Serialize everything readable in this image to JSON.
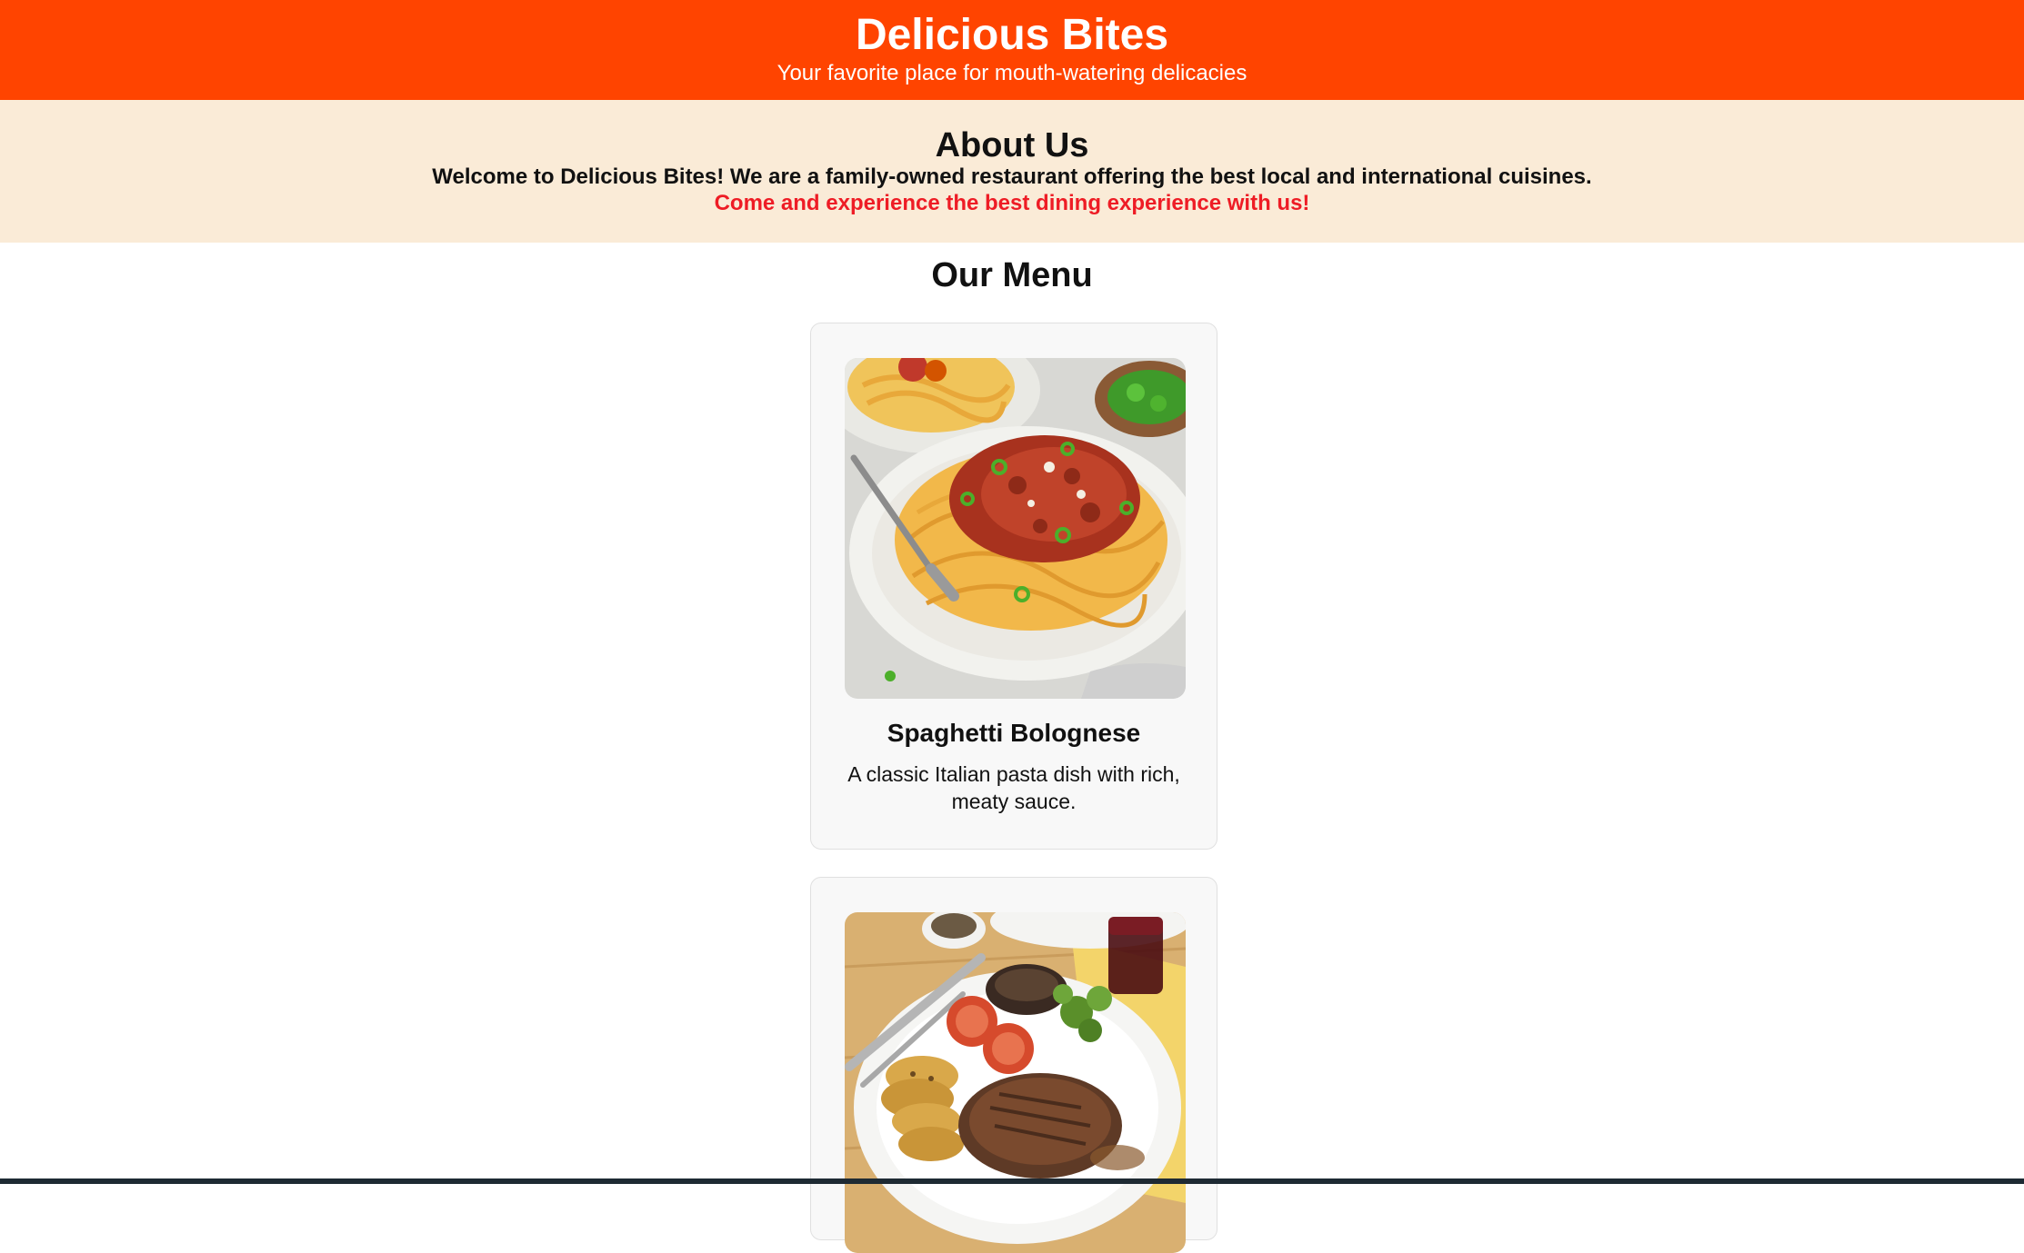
{
  "header": {
    "title": "Delicious Bites",
    "tagline": "Your favorite place for mouth-watering delicacies"
  },
  "about": {
    "heading": "About Us",
    "intro": "Welcome to Delicious Bites! We are a family-owned restaurant offering the best local and international cuisines.",
    "cta": "Come and experience the best dining experience with us!"
  },
  "menu": {
    "heading": "Our Menu",
    "items": [
      {
        "name": "Spaghetti Bolognese",
        "description": "A classic Italian pasta dish with rich, meaty sauce.",
        "image": "spaghetti-bolognese-photo"
      },
      {
        "name": "",
        "description": "",
        "image": "steak-plate-photo"
      }
    ]
  },
  "colors": {
    "header_bg": "#ff4400",
    "about_bg": "#faebd7",
    "cta_text": "#ee1c25",
    "card_bg": "#f8f8f8"
  }
}
